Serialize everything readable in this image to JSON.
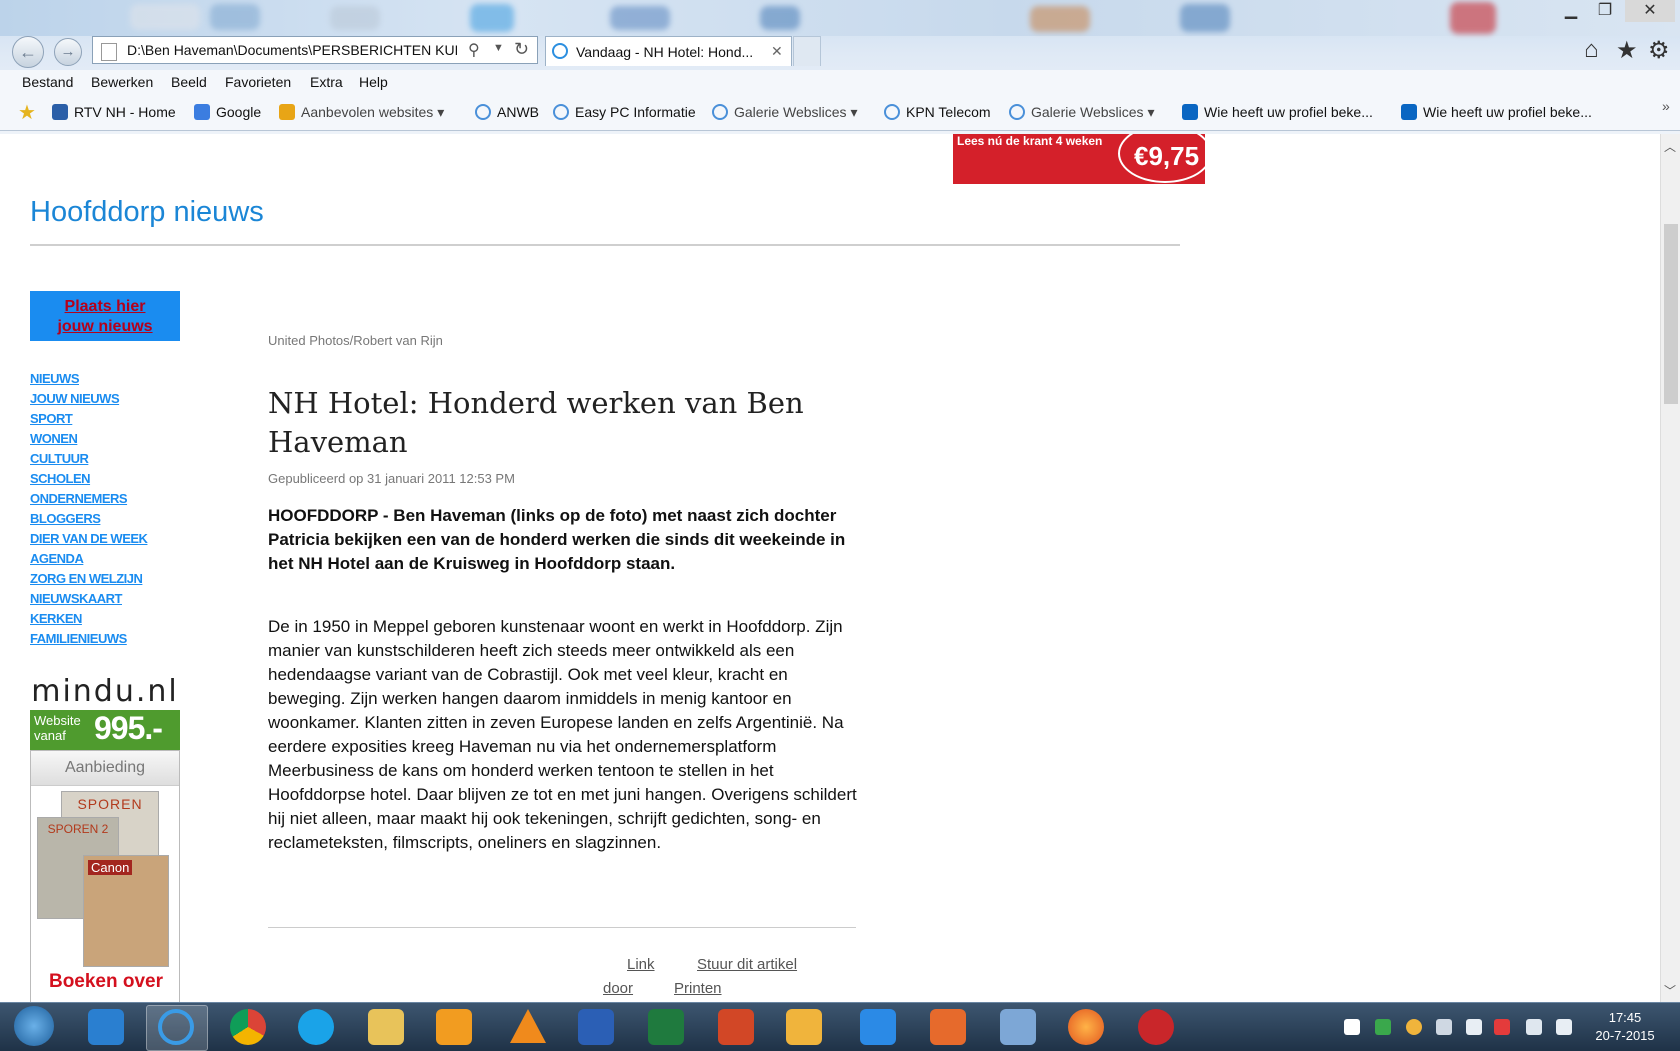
{
  "browser": {
    "address": "D:\\Ben Haveman\\Documents\\PERSBERICHTEN KUI",
    "tab_title": "Vandaag - NH Hotel: Hond...",
    "tab_close": "✕",
    "menu": [
      "Bestand",
      "Bewerken",
      "Beeld",
      "Favorieten",
      "Extra",
      "Help"
    ],
    "favorites": [
      {
        "label": "RTV NH - Home",
        "icon": "rtvnh-icon",
        "color": "#2b5fa8"
      },
      {
        "label": "Google",
        "icon": "google-icon",
        "color": "#3b7de0"
      },
      {
        "label": "Aanbevolen websites ▾",
        "icon": "bing-icon",
        "color": "#e8a516"
      },
      {
        "label": "ANWB",
        "icon": "ie-page-icon",
        "color": "#4a90d9"
      },
      {
        "label": "Easy PC Informatie",
        "icon": "ie-page-icon",
        "color": "#4a90d9"
      },
      {
        "label": "Galerie Webslices ▾",
        "icon": "ie-page-icon",
        "color": "#4a90d9"
      },
      {
        "label": "KPN Telecom",
        "icon": "ie-page-icon",
        "color": "#4a90d9"
      },
      {
        "label": "Galerie Webslices ▾",
        "icon": "ie-page-icon",
        "color": "#4a90d9"
      },
      {
        "label": "Wie heeft uw profiel beke...",
        "icon": "linkedin-icon",
        "color": "#0a66c2"
      },
      {
        "label": "Wie heeft uw profiel beke...",
        "icon": "linkedin-icon",
        "color": "#0a66c2"
      }
    ],
    "more_chevron": "»"
  },
  "page": {
    "ad": {
      "text": "Lees nú de krant 4 weken",
      "price": "€9,75"
    },
    "site_title": "Hoofddorp nieuws",
    "place_news": "Plaats hier jouw nieuws",
    "nav": [
      "NIEUWS",
      "JOUW NIEUWS",
      "SPORT",
      "WONEN",
      "CULTUUR",
      "SCHOLEN",
      "ONDERNEMERS",
      "BLOGGERS",
      "DIER VAN DE WEEK",
      "AGENDA",
      "ZORG EN WELZIJN",
      "NIEUWSKAART",
      "KERKEN",
      "FAMILIENIEUWS"
    ],
    "mindu": {
      "logo": "mindu.nl",
      "offer_small": "Website vanaf",
      "offer_price": "995.-"
    },
    "aanbieding": {
      "title": "Aanbieding",
      "book1": "SPOREN",
      "book2": "SPOREN 2",
      "book3": "Canon",
      "footer": "Boeken over"
    },
    "article": {
      "photo_credit": "United Photos/Robert van Rijn",
      "headline": "NH Hotel: Honderd werken van Ben Haveman",
      "published": "Gepubliceerd op 31 januari 2011 12:53 PM",
      "lead": "HOOFDDORP - Ben Haveman (links op de foto) met naast zich dochter Patricia bekijken een van de honderd werken die sinds dit weekeinde in het NH Hotel aan de Kruisweg in Hoofddorp staan.",
      "body": "De in 1950 in Meppel geboren kunstenaar woont en werkt in Hoofddorp. Zijn manier van kunstschilderen heeft zich steeds meer ontwikkeld als een hedendaagse variant van de Cobrastijl. Ook met veel kleur, kracht en beweging. Zijn werken hangen daarom inmiddels in menig kantoor en woonkamer. Klanten zitten in zeven Europese landen en zelfs Argentinië. Na eerdere exposities kreeg Haveman nu via het ondernemersplatform Meerbusiness de kans om honderd werken tentoon te stellen in het Hoofddorpse hotel. Daar blijven ze tot en met juni hangen. Overigens schildert hij niet alleen, maar maakt hij ook tekeningen, schrijft gedichten, song- en reclameteksten, filmscripts, oneliners en slagzinnen.",
      "link_label": "Link",
      "send_label": "Stuur dit artikel",
      "door_label": "door",
      "print_label": "Printen"
    }
  },
  "taskbar": {
    "time": "17:45",
    "date": "20-7-2015"
  }
}
